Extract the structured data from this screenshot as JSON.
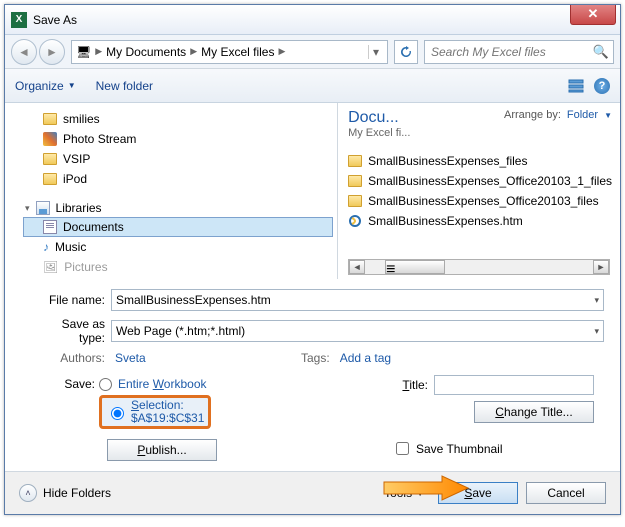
{
  "window": {
    "title": "Save As",
    "close": "✕"
  },
  "nav": {
    "home_icon": "🖥",
    "crumbs": [
      "My Documents",
      "My Excel files"
    ],
    "search_placeholder": "Search My Excel files"
  },
  "toolbar": {
    "organize": "Organize",
    "newfolder": "New folder"
  },
  "tree": {
    "items": [
      {
        "icon": "folder",
        "label": "smilies"
      },
      {
        "icon": "photo",
        "label": "Photo Stream"
      },
      {
        "icon": "folder",
        "label": "VSIP"
      },
      {
        "icon": "folder",
        "label": "iPod"
      }
    ],
    "lib_header": "Libraries",
    "libs": [
      {
        "icon": "doc",
        "label": "Documents",
        "sel": true
      },
      {
        "icon": "music",
        "label": "Music"
      },
      {
        "icon": "pic",
        "label": "Pictures"
      }
    ]
  },
  "right": {
    "title": "Docu...",
    "sub": "My Excel fi...",
    "arrange": "Arrange by:",
    "arrange_val": "Folder",
    "files": [
      {
        "icon": "folder",
        "name": "SmallBusinessExpenses_files"
      },
      {
        "icon": "folder",
        "name": "SmallBusinessExpenses_Office20103_1_files"
      },
      {
        "icon": "folder",
        "name": "SmallBusinessExpenses_Office20103_files"
      },
      {
        "icon": "ie",
        "name": "SmallBusinessExpenses.htm"
      }
    ]
  },
  "form": {
    "filename_label": "File name:",
    "filename": "SmallBusinessExpenses.htm",
    "savetype_label": "Save as type:",
    "savetype": "Web Page (*.htm;*.html)",
    "authors_label": "Authors:",
    "authors": "Sveta",
    "tags_label": "Tags:",
    "tags": "Add a tag",
    "save_label": "Save:",
    "entire_wb": "Entire Workbook",
    "selection": "Selection:",
    "selection_range": "$A$19:$C$31",
    "publish": "Publish...",
    "title_label": "Title:",
    "change_title": "Change Title...",
    "save_thumb": "Save Thumbnail"
  },
  "footer": {
    "hide": "Hide Folders",
    "tools": "Tools",
    "save": "Save",
    "cancel": "Cancel"
  }
}
